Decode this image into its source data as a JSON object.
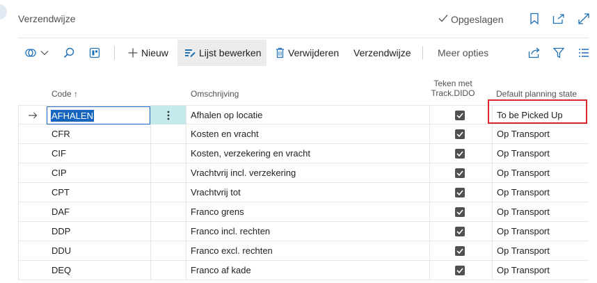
{
  "header": {
    "title": "Verzendwijze",
    "saved_label": "Opgeslagen"
  },
  "toolbar": {
    "new_label": "Nieuw",
    "edit_list_label": "Lijst bewerken",
    "delete_label": "Verwijderen",
    "shipment_label": "Verzendwijze",
    "more_label": "Meer opties"
  },
  "columns": {
    "code": "Code",
    "sort_arrow": "↑",
    "description": "Omschrijving",
    "track_line1": "Teken met",
    "track_line2": "Track.DIDO",
    "planning": "Default planning state"
  },
  "rows": [
    {
      "code": "AFHALEN",
      "description": "Afhalen op locatie",
      "track": true,
      "planning": "To be Picked Up",
      "selected": true
    },
    {
      "code": "CFR",
      "description": "Kosten en vracht",
      "track": true,
      "planning": "Op Transport"
    },
    {
      "code": "CIF",
      "description": "Kosten, verzekering en vracht",
      "track": true,
      "planning": "Op Transport"
    },
    {
      "code": "CIP",
      "description": "Vrachtvrij incl. verzekering",
      "track": true,
      "planning": "Op Transport"
    },
    {
      "code": "CPT",
      "description": "Vrachtvrij tot",
      "track": true,
      "planning": "Op Transport"
    },
    {
      "code": "DAF",
      "description": "Franco grens",
      "track": true,
      "planning": "Op Transport"
    },
    {
      "code": "DDP",
      "description": "Franco incl. rechten",
      "track": true,
      "planning": "Op Transport"
    },
    {
      "code": "DDU",
      "description": "Franco excl. rechten",
      "track": true,
      "planning": "Op Transport"
    },
    {
      "code": "DEQ",
      "description": "Franco af kade",
      "track": true,
      "planning": "Op Transport"
    }
  ],
  "icons": {
    "filter_pane": "filter-pane-icon",
    "search": "search-icon",
    "analysis": "analysis-icon",
    "plus": "plus-icon",
    "edit_list": "edit-list-icon",
    "delete": "trash-icon",
    "share": "share-icon",
    "filter": "filter-icon",
    "list": "list-view-icon",
    "bookmark": "bookmark-icon",
    "open_new": "open-new-window-icon",
    "expand": "expand-icon",
    "row_arrow": "row-indicator-arrow-icon",
    "checkmark": "checkmark-icon"
  },
  "colors": {
    "accent": "#1565c0",
    "selection_cell": "#c4eaee",
    "highlight": "#d9262f"
  }
}
